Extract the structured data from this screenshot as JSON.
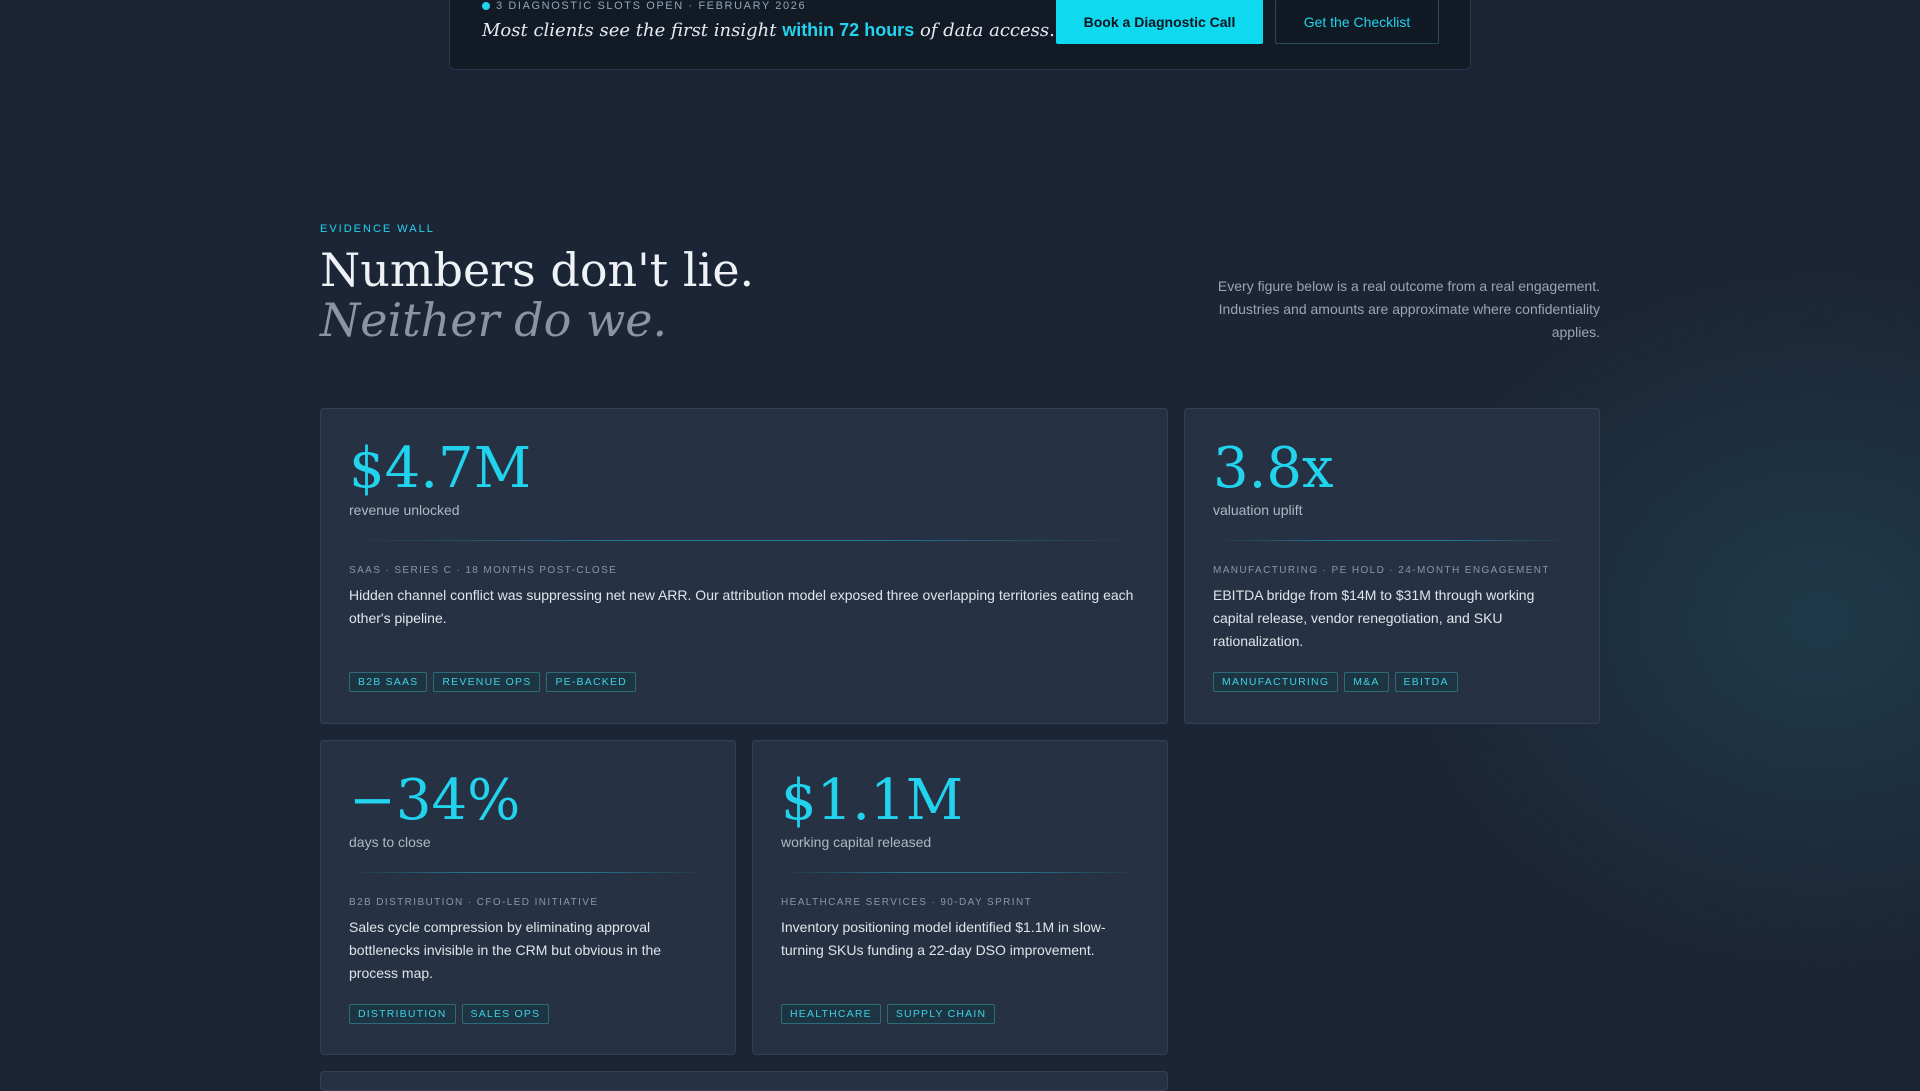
{
  "banner": {
    "slots": "3 DIAGNOSTIC SLOTS OPEN · FEBRUARY 2026",
    "tagline_pre": "Most clients see the first insight",
    "tagline_highlight": "within 72 hours",
    "tagline_post": "of data access.",
    "primary_cta": "Book a Diagnostic Call",
    "secondary_cta": "Get the Checklist"
  },
  "section": {
    "eyebrow": "EVIDENCE WALL",
    "title": "Numbers don't lie.",
    "title_italic": "Neither do we.",
    "intro": "Every figure below is a real outcome from a real engagement. Industries and amounts are approximate where confidentiality applies."
  },
  "cards": [
    {
      "metric": "$4.7M",
      "label": "revenue unlocked",
      "meta": "SAAS · SERIES C · 18 MONTHS POST-CLOSE",
      "description": "Hidden channel conflict was suppressing net new ARR. Our attribution model exposed three overlapping territories eating each other's pipeline.",
      "tags": [
        "B2B SAAS",
        "REVENUE OPS",
        "PE-BACKED"
      ]
    },
    {
      "metric": "3.8x",
      "label": "valuation uplift",
      "meta": "MANUFACTURING · PE HOLD · 24-MONTH ENGAGEMENT",
      "description": "EBITDA bridge from $14M to $31M through working capital release, vendor renegotiation, and SKU rationalization.",
      "tags": [
        "MANUFACTURING",
        "M&A",
        "EBITDA"
      ]
    },
    {
      "metric": "−34%",
      "label": "days to close",
      "meta": "B2B DISTRIBUTION · CFO-LED INITIATIVE",
      "description": "Sales cycle compression by eliminating approval bottlenecks invisible in the CRM but obvious in the process map.",
      "tags": [
        "DISTRIBUTION",
        "SALES OPS"
      ]
    },
    {
      "metric": "$1.1M",
      "label": "working capital released",
      "meta": "HEALTHCARE SERVICES · 90-DAY SPRINT",
      "description": "Inventory positioning model identified $1.1M in slow-turning SKUs funding a 22-day DSO improvement.",
      "tags": [
        "HEALTHCARE",
        "SUPPLY CHAIN"
      ]
    }
  ],
  "colors": {
    "accent": "#22d3ee",
    "background": "#1c2535",
    "card": "#263244"
  }
}
